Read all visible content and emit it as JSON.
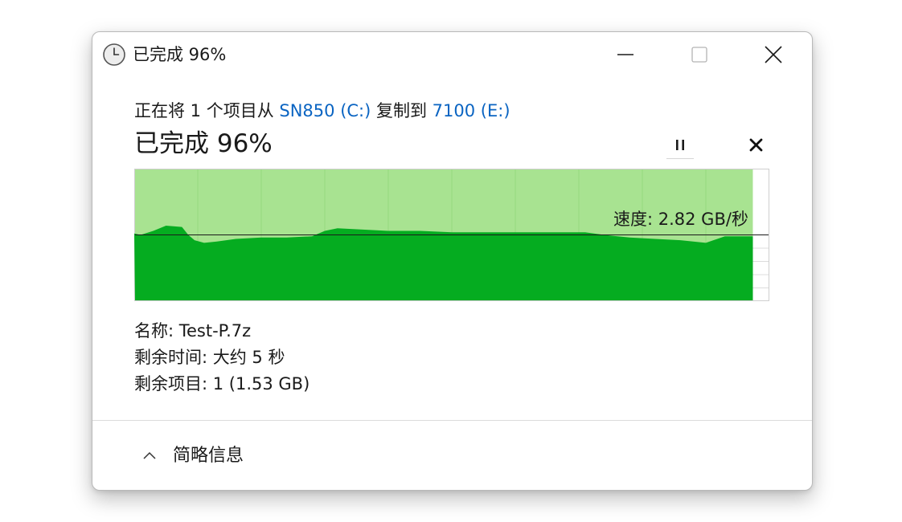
{
  "window": {
    "title": "已完成 96%",
    "icon": "clock-icon",
    "controls": {
      "minimize": "minimize-icon",
      "maximize": "maximize-icon",
      "close": "close-icon"
    }
  },
  "copy": {
    "prefix": "正在将 1 个项目从 ",
    "source": "SN850 (C:)",
    "middle": " 复制到 ",
    "destination": "7100 (E:)"
  },
  "progress": {
    "label": "已完成 96%",
    "percent": 96
  },
  "actions": {
    "pause": "pause-icon",
    "cancel": "cancel-icon"
  },
  "speed": {
    "label": "速度: 2.82 GB/秒"
  },
  "chart_data": {
    "type": "area",
    "title": "",
    "xlabel": "",
    "ylabel": "",
    "progress_fraction": 0.974,
    "current_speed_level": 0.5,
    "x": [
      0.0,
      0.01,
      0.03,
      0.05,
      0.075,
      0.085,
      0.095,
      0.11,
      0.13,
      0.16,
      0.2,
      0.24,
      0.28,
      0.3,
      0.32,
      0.36,
      0.4,
      0.45,
      0.5,
      0.55,
      0.6,
      0.65,
      0.7,
      0.71,
      0.74,
      0.78,
      0.82,
      0.86,
      0.88,
      0.9,
      0.93,
      0.974
    ],
    "y": [
      0.51,
      0.5,
      0.53,
      0.57,
      0.56,
      0.5,
      0.46,
      0.44,
      0.45,
      0.47,
      0.48,
      0.48,
      0.49,
      0.53,
      0.55,
      0.54,
      0.53,
      0.53,
      0.52,
      0.52,
      0.52,
      0.52,
      0.52,
      0.52,
      0.5,
      0.48,
      0.47,
      0.46,
      0.45,
      0.44,
      0.49,
      0.49
    ],
    "colors": {
      "filled": "#05ac20",
      "remaining_area": "#a8e391",
      "grid": "#96d880",
      "line": "#1a1a1a",
      "border": "#cfcfcf"
    },
    "grid": true
  },
  "details": {
    "name": "名称: Test-P.7z",
    "time_remaining": "剩余时间: 大约 5 秒",
    "items_remaining": "剩余项目: 1 (1.53 GB)"
  },
  "footer": {
    "toggle_label": "简略信息",
    "icon": "chevron-up-icon"
  }
}
